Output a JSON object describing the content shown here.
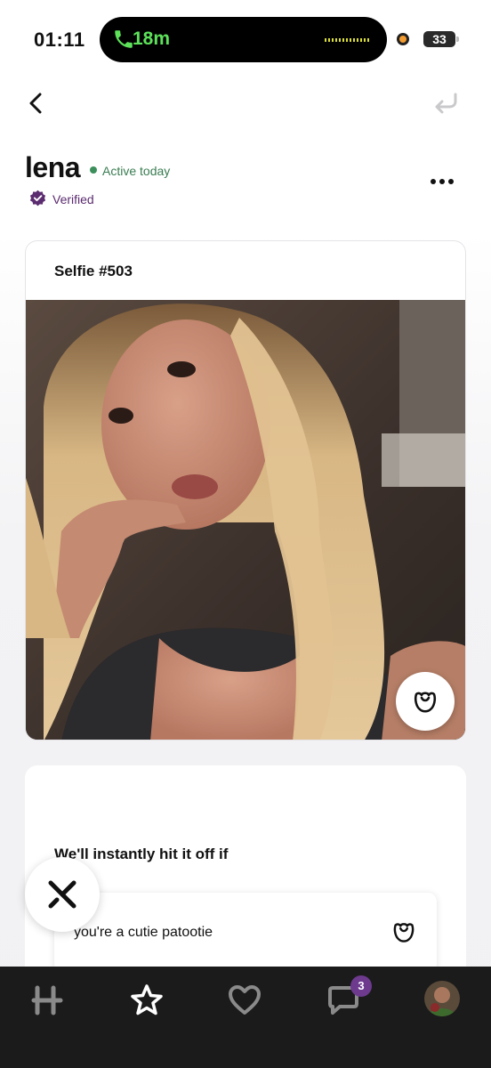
{
  "status_bar": {
    "time": "01:11",
    "call_duration": "18m",
    "battery": "33",
    "call_color": "#5de25a"
  },
  "header": {
    "back_icon": "chevron-left-icon",
    "undo_icon": "undo-arrow-icon"
  },
  "profile": {
    "name": "lena",
    "active_status": "Active today",
    "verified_label": "Verified",
    "more_icon": "ellipsis-icon",
    "accent_color": "#5b2c6f",
    "active_color": "#3a7d52"
  },
  "photo_card": {
    "title": "Selfie #503",
    "like_icon": "rose-icon"
  },
  "prompt_card": {
    "question": "We'll instantly hit it off if",
    "answer": "you're a cutie patootie",
    "like_icon": "rose-icon"
  },
  "skip_icon": "x-icon",
  "bottom_nav": {
    "items": [
      {
        "name": "home",
        "icon": "hinge-logo-icon"
      },
      {
        "name": "standouts",
        "icon": "star-icon"
      },
      {
        "name": "likes-you",
        "icon": "heart-icon"
      },
      {
        "name": "matches",
        "icon": "chat-bubble-icon",
        "badge": "3"
      },
      {
        "name": "profile",
        "icon": "avatar"
      }
    ],
    "badge_color": "#6d3a8e"
  }
}
